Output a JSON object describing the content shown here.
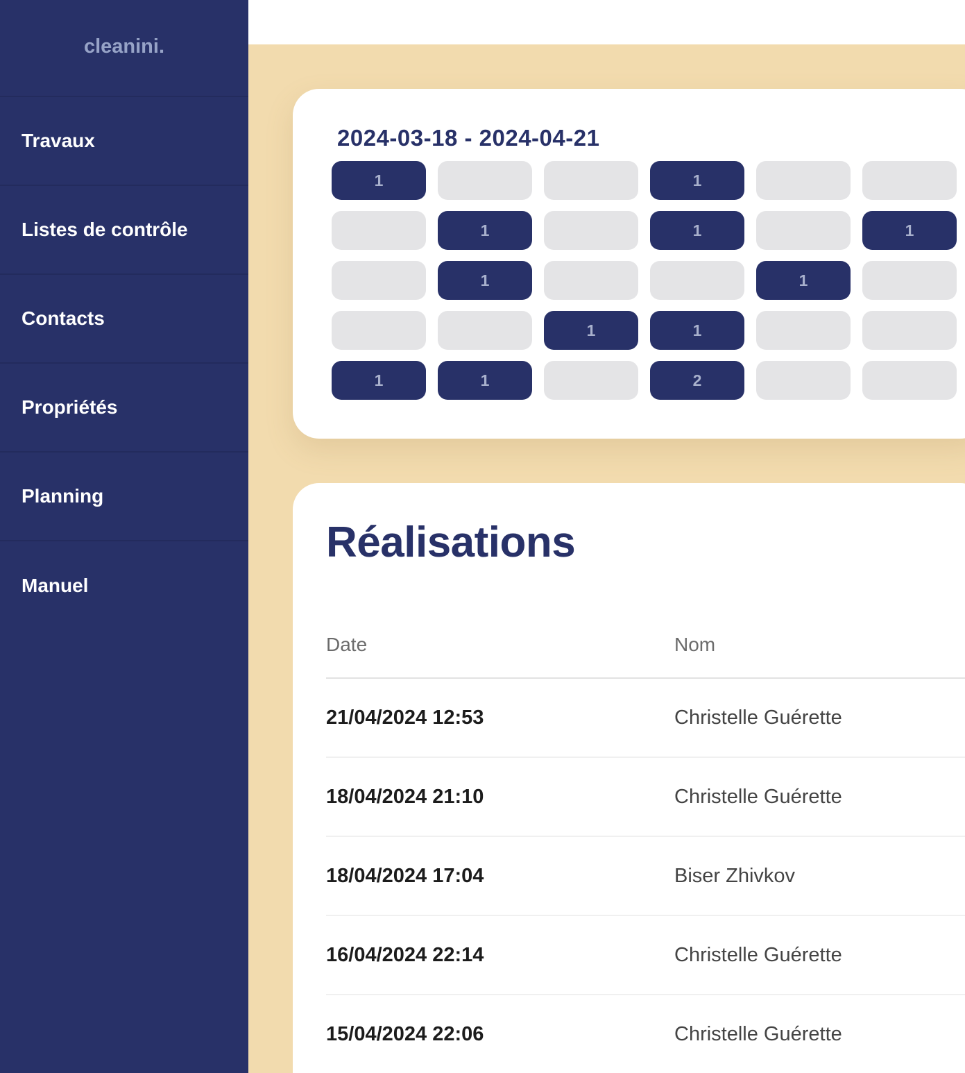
{
  "sidebar": {
    "logo": "cleanini.",
    "items": [
      {
        "label": "Travaux"
      },
      {
        "label": "Listes de contrôle"
      },
      {
        "label": "Contacts"
      },
      {
        "label": "Propriétés"
      },
      {
        "label": "Planning"
      },
      {
        "label": "Manuel"
      }
    ]
  },
  "calendar": {
    "range": "2024-03-18 - 2024-04-21",
    "rows": [
      [
        "1",
        "",
        "",
        "1",
        "",
        ""
      ],
      [
        "",
        "1",
        "",
        "1",
        "",
        "1"
      ],
      [
        "",
        "1",
        "",
        "",
        "1",
        ""
      ],
      [
        "",
        "",
        "1",
        "1",
        "",
        ""
      ],
      [
        "1",
        "1",
        "",
        "2",
        "",
        ""
      ]
    ]
  },
  "realisations": {
    "title": "Réalisations",
    "columns": {
      "date": "Date",
      "nom": "Nom"
    },
    "rows": [
      {
        "date": "21/04/2024 12:53",
        "nom": "Christelle Guérette"
      },
      {
        "date": "18/04/2024 21:10",
        "nom": "Christelle Guérette"
      },
      {
        "date": "18/04/2024 17:04",
        "nom": "Biser Zhivkov"
      },
      {
        "date": "16/04/2024 22:14",
        "nom": "Christelle Guérette"
      },
      {
        "date": "15/04/2024 22:06",
        "nom": "Christelle Guérette"
      }
    ]
  },
  "colors": {
    "navy": "#283168",
    "background": "#f2dbae",
    "empty_cell": "#e4e4e6"
  }
}
